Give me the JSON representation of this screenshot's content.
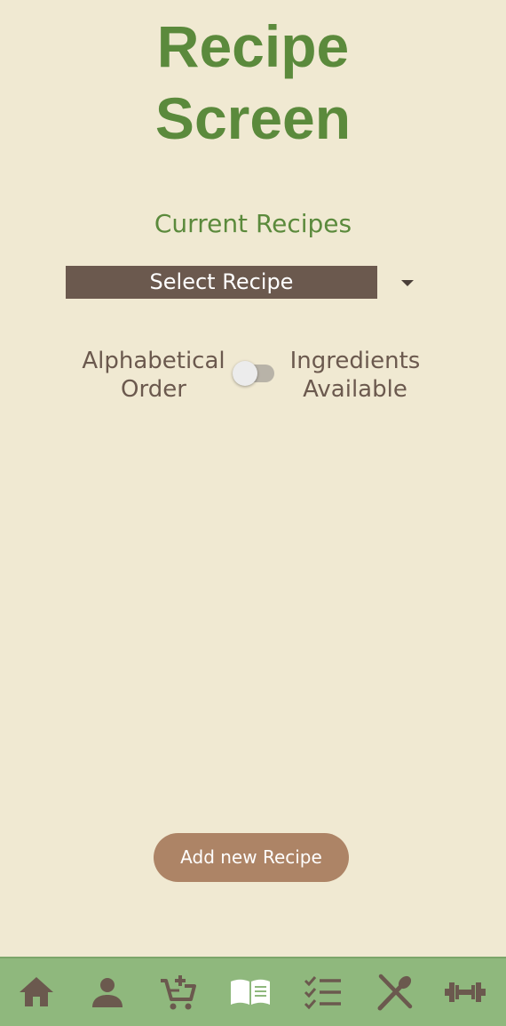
{
  "header": {
    "title_line1": "Recipe",
    "title_line2": "Screen"
  },
  "recipes": {
    "heading": "Current Recipes",
    "select_value": "Select Recipe"
  },
  "sort_toggle": {
    "left_label_line1": "Alphabetical",
    "left_label_line2": "Order",
    "right_label_line1": "Ingredients",
    "right_label_line2": "Available",
    "state": "off"
  },
  "actions": {
    "add_label": "Add new Recipe"
  },
  "bottom_nav": {
    "items": [
      {
        "icon": "home-icon",
        "active": false
      },
      {
        "icon": "profile-icon",
        "active": false
      },
      {
        "icon": "add-to-cart-icon",
        "active": false
      },
      {
        "icon": "recipe-book-icon",
        "active": true
      },
      {
        "icon": "checklist-icon",
        "active": false
      },
      {
        "icon": "utensils-icon",
        "active": false
      },
      {
        "icon": "dumbbell-icon",
        "active": false
      }
    ]
  },
  "colors": {
    "background": "#f0e9d2",
    "title_green": "#5b8a3c",
    "select_brown": "#6b594e",
    "button_tan": "#ad8466",
    "nav_green": "#8fb87d",
    "icon_brown": "#6b594e",
    "icon_active": "#ffffff"
  }
}
